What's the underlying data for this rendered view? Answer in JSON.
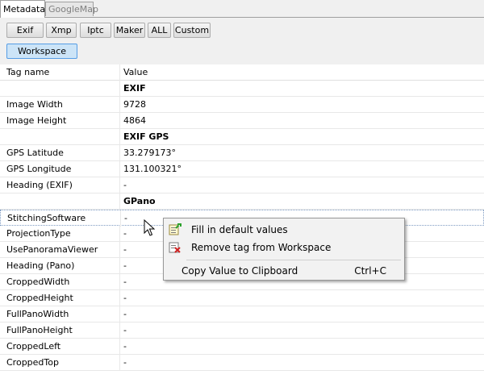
{
  "tabs": [
    {
      "label": "Metadata",
      "active": true
    },
    {
      "label": "GoogleMap",
      "active": false
    }
  ],
  "toolbar": {
    "buttons": [
      "Exif",
      "Xmp",
      "Iptc",
      "Maker",
      "ALL",
      "Custom"
    ],
    "workspace_label": "Workspace"
  },
  "table": {
    "columns": [
      "Tag name",
      "Value"
    ],
    "rows": [
      {
        "tag": "",
        "value": "EXIF",
        "group": true
      },
      {
        "tag": "Image Width",
        "value": "9728"
      },
      {
        "tag": "Image Height",
        "value": "4864"
      },
      {
        "tag": "",
        "value": "EXIF GPS",
        "group": true
      },
      {
        "tag": "GPS Latitude",
        "value": "33.279173°"
      },
      {
        "tag": "GPS Longitude",
        "value": "131.100321°"
      },
      {
        "tag": "Heading (EXIF)",
        "value": "-"
      },
      {
        "tag": "",
        "value": "GPano",
        "group": true
      },
      {
        "tag": "StitchingSoftware",
        "value": "-",
        "selected": true
      },
      {
        "tag": "ProjectionType",
        "value": "-"
      },
      {
        "tag": "UsePanoramaViewer",
        "value": "-"
      },
      {
        "tag": "Heading (Pano)",
        "value": "-"
      },
      {
        "tag": "CroppedWidth",
        "value": "-"
      },
      {
        "tag": "CroppedHeight",
        "value": "-"
      },
      {
        "tag": "FullPanoWidth",
        "value": "-"
      },
      {
        "tag": "FullPanoHeight",
        "value": "-"
      },
      {
        "tag": "CroppedLeft",
        "value": "-"
      },
      {
        "tag": "CroppedTop",
        "value": "-"
      }
    ]
  },
  "context_menu": {
    "items": [
      {
        "label": "Fill in default values",
        "icon": "fill-default-icon"
      },
      {
        "label": "Remove tag from Workspace",
        "icon": "remove-tag-icon"
      },
      {
        "label": "Copy Value to Clipboard",
        "shortcut": "Ctrl+C"
      }
    ]
  }
}
